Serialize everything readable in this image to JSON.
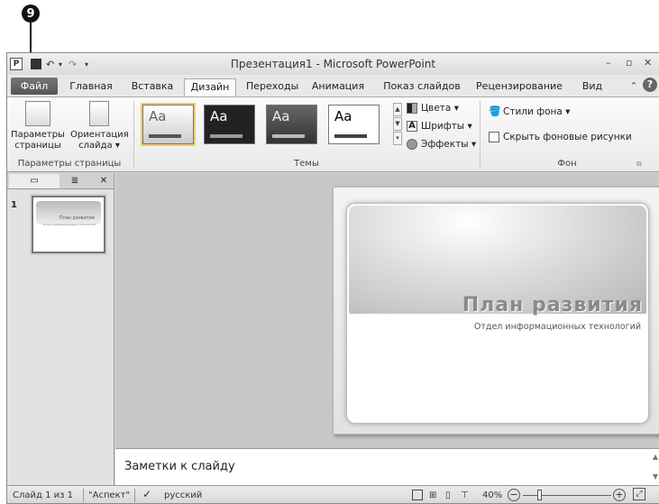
{
  "callout": "9",
  "window": {
    "title": "Презентация1 - Microsoft PowerPoint",
    "app_icon": "P"
  },
  "qat": {
    "save_icon": "save-icon",
    "undo": "↶",
    "dropdown": "▾",
    "redo": "↷"
  },
  "window_controls": [
    "–",
    "▫",
    "✕"
  ],
  "tabs": [
    "Файл",
    "Главная",
    "Вставка",
    "Дизайн",
    "Переходы",
    "Анимация",
    "Показ слайдов",
    "Рецензирование",
    "Вид"
  ],
  "ribbon": {
    "page_setup": {
      "btn1": "Параметры страницы",
      "btn2": "Ориентация слайда ▾",
      "group": "Параметры страницы"
    },
    "themes": {
      "sample": "Aa",
      "group": "Темы",
      "colors": "Цвета ▾",
      "fonts": "Шрифты ▾",
      "effects": "Эффекты ▾"
    },
    "background": {
      "styles": "Стили фона ▾",
      "hide": "Скрыть фоновые рисунки",
      "group": "Фон"
    }
  },
  "slides_panel": {
    "thumb_number": "1",
    "thumb_title": "План развития",
    "thumb_sub": "Отдел информационных технологий"
  },
  "slide": {
    "title": "План развития",
    "subtitle": "Отдел информационных технологий"
  },
  "notes": {
    "placeholder": "Заметки к слайду"
  },
  "status": {
    "slide_info": "Слайд 1 из 1",
    "theme": "\"Аспект\"",
    "language": "русский",
    "zoom": "40%"
  },
  "colors": {
    "file_tab": "#666666",
    "ribbon": "#f2f2f2",
    "workspace": "#c8c8c8"
  }
}
